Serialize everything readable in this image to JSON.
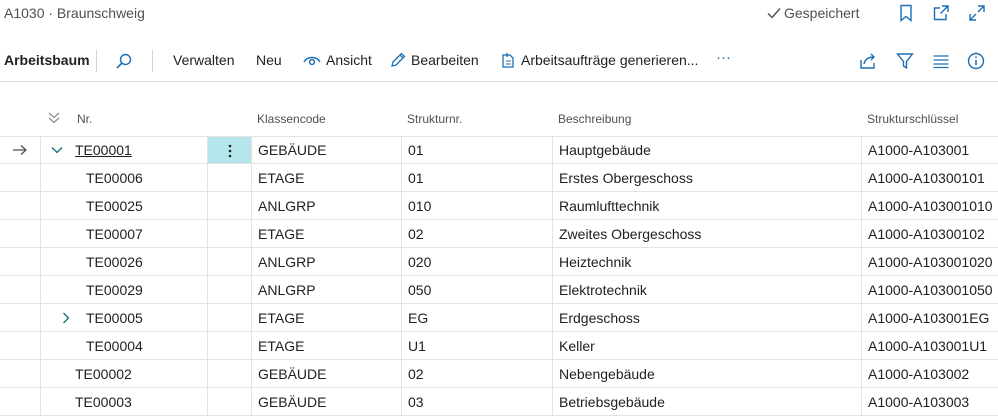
{
  "window": {
    "title": "A1030 · Braunschweig",
    "saved_label": "Gespeichert"
  },
  "actions": {
    "page_label": "Arbeitsbaum",
    "manage": "Verwalten",
    "new": "Neu",
    "view": "Ansicht",
    "edit": "Bearbeiten",
    "generate": "Arbeitsaufträge generieren...",
    "more": "···"
  },
  "columns": {
    "nr": "Nr.",
    "class_code": "Klassencode",
    "structure_no": "Strukturnr.",
    "description": "Beschreibung",
    "structure_key": "Strukturschlüssel"
  },
  "rows": [
    {
      "nr": "TE00001",
      "class_code": "GEBÄUDE",
      "structure_no": "01",
      "description": "Hauptgebäude",
      "structure_key": "A1000-A103001"
    },
    {
      "nr": "TE00006",
      "class_code": "ETAGE",
      "structure_no": "01",
      "description": "Erstes Obergeschoss",
      "structure_key": "A1000-A10300101"
    },
    {
      "nr": "TE00025",
      "class_code": "ANLGRP",
      "structure_no": "010",
      "description": "Raumlufttechnik",
      "structure_key": "A1000-A103001010"
    },
    {
      "nr": "TE00007",
      "class_code": "ETAGE",
      "structure_no": "02",
      "description": "Zweites Obergeschoss",
      "structure_key": "A1000-A10300102"
    },
    {
      "nr": "TE00026",
      "class_code": "ANLGRP",
      "structure_no": "020",
      "description": "Heiztechnik",
      "structure_key": "A1000-A103001020"
    },
    {
      "nr": "TE00029",
      "class_code": "ANLGRP",
      "structure_no": "050",
      "description": "Elektrotechnik",
      "structure_key": "A1000-A103001050"
    },
    {
      "nr": "TE00005",
      "class_code": "ETAGE",
      "structure_no": "EG",
      "description": "Erdgeschoss",
      "structure_key": "A1000-A103001EG"
    },
    {
      "nr": "TE00004",
      "class_code": "ETAGE",
      "structure_no": "U1",
      "description": "Keller",
      "structure_key": "A1000-A103001U1"
    },
    {
      "nr": "TE00002",
      "class_code": "GEBÄUDE",
      "structure_no": "02",
      "description": "Nebengebäude",
      "structure_key": "A1000-A103002"
    },
    {
      "nr": "TE00003",
      "class_code": "GEBÄUDE",
      "structure_no": "03",
      "description": "Betriebsgebäude",
      "structure_key": "A1000-A103003"
    }
  ],
  "colors": {
    "accent": "#0f6b76",
    "selected_cell": "#b5e6ec",
    "gridline": "#e3e3e3",
    "icon_blue": "#1c6fb5"
  },
  "icons": [
    "checkmark-icon",
    "bookmark-icon",
    "open-new-window-icon",
    "expand-icon",
    "search-icon",
    "eye-icon",
    "pencil-icon",
    "generate-icon",
    "share-icon",
    "filter-icon",
    "list-icon",
    "info-icon",
    "collapse-all-icon",
    "arrow-right-icon",
    "chevron-down-icon",
    "chevron-right-icon",
    "more-vertical-icon"
  ]
}
